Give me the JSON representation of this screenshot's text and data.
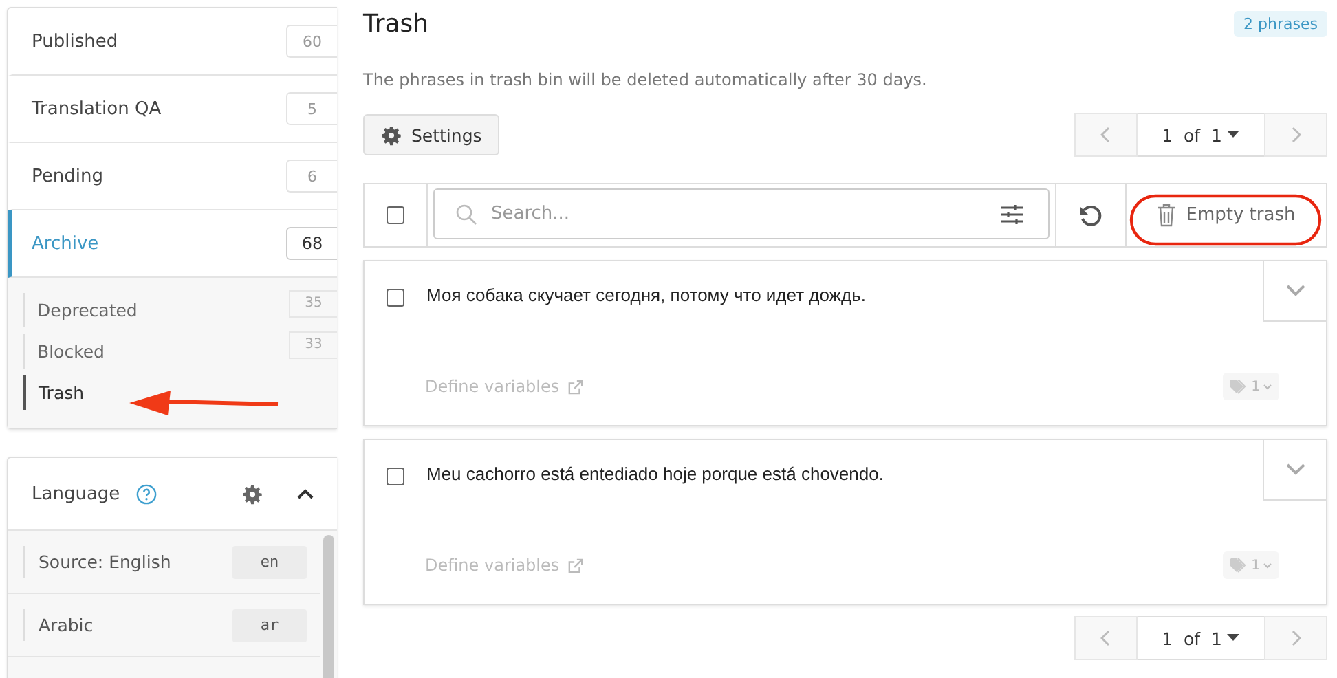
{
  "sidebar": {
    "statuses": [
      {
        "label": "Published",
        "count": "60",
        "selected": false
      },
      {
        "label": "Translation QA",
        "count": "5",
        "selected": false
      },
      {
        "label": "Pending",
        "count": "6",
        "selected": false
      },
      {
        "label": "Archive",
        "count": "68",
        "selected": true,
        "children": [
          {
            "label": "Deprecated",
            "count": "35",
            "selected": false
          },
          {
            "label": "Blocked",
            "count": "33",
            "selected": false
          },
          {
            "label": "Trash",
            "selected": true
          }
        ]
      }
    ],
    "language": {
      "title": "Language",
      "expanded": true,
      "items": [
        {
          "label": "Source: English",
          "code": "en"
        },
        {
          "label": "Arabic",
          "code": "ar"
        }
      ]
    }
  },
  "main": {
    "title": "Trash",
    "badge": "2 phrases",
    "note": "The phrases in trash bin will be deleted automatically after 30 days.",
    "settings_button": "Settings",
    "pagination": {
      "current": "1",
      "of": "of",
      "total": "1"
    },
    "toolbar": {
      "select_all": false,
      "search_placeholder": "Search...",
      "empty_button": "Empty trash"
    },
    "phrases": [
      {
        "text": "Моя собака скучает сегодня, потому что идет дождь.",
        "checked": false,
        "link": "Define variables",
        "tags": "1"
      },
      {
        "text": "Meu cachorro está entediado hoje porque está chovendo.",
        "checked": false,
        "link": "Define variables",
        "tags": "1"
      }
    ],
    "bottom_pagination": {
      "current": "1",
      "of": "of",
      "total": "1"
    }
  }
}
